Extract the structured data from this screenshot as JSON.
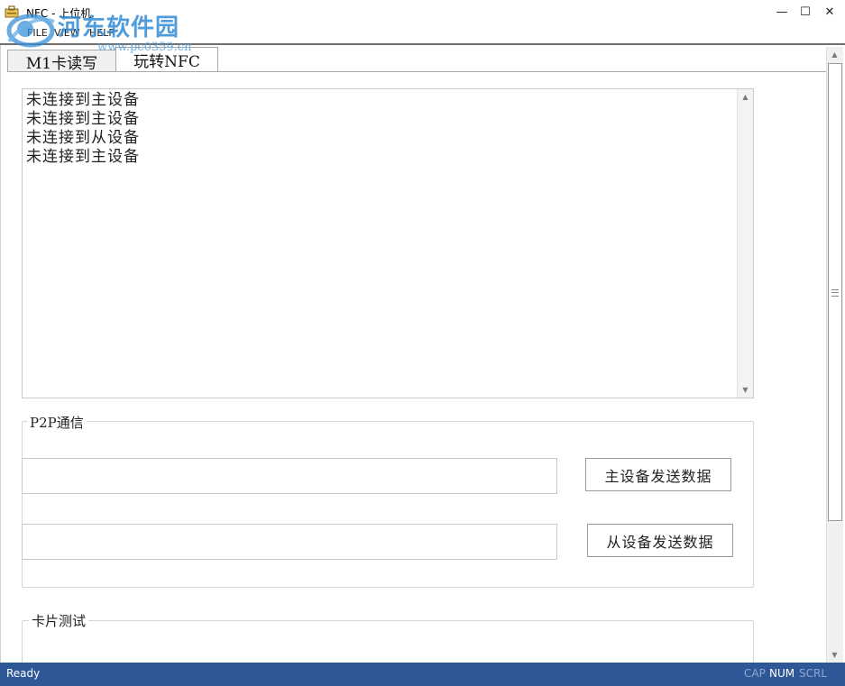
{
  "window": {
    "title": "NFC - 上位机",
    "min_glyph": "—",
    "max_glyph": "☐",
    "close_glyph": "✕"
  },
  "menu": [
    "FILE",
    "VIEW",
    "HELP"
  ],
  "watermark": {
    "title": "河东软件园",
    "url": "www.pc0359.cn"
  },
  "tabs": [
    {
      "label": "M1卡读写",
      "active": false
    },
    {
      "label": "玩转NFC",
      "active": true
    }
  ],
  "log": {
    "lines": [
      "未连接到主设备",
      "未连接到主设备",
      "未连接到从设备",
      "未连接到主设备"
    ],
    "up": "▲",
    "down": "▼"
  },
  "p2p": {
    "label": "P2P通信",
    "master_value": "",
    "slave_value": "",
    "master_button": "主设备发送数据",
    "slave_button": "从设备发送数据"
  },
  "card_test": {
    "label": "卡片测试"
  },
  "scrollbar": {
    "up": "▲",
    "down": "▼"
  },
  "status": {
    "ready": "Ready",
    "cap": "CAP",
    "num": "NUM",
    "scrl": "SCRL"
  },
  "colors": {
    "statusbar": "#2d5797",
    "watermark": "#3a8fd6"
  }
}
